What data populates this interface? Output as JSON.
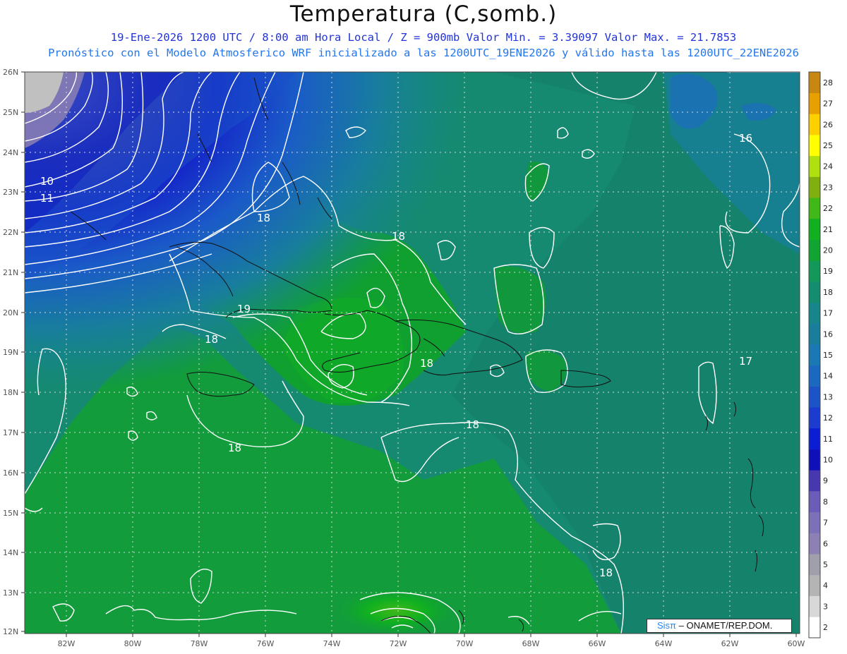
{
  "header": {
    "title": "Temperatura (C,somb.)",
    "line1": "19-Ene-2026  1200 UTC / 8:00 am Hora Local / Z = 900mb   Valor Min. = 3.39097  Valor Max. = 21.7853",
    "line2": "Pronóstico con el Modelo Atmosferico WRF inicializado a las 1200UTC_19ENE2026 y válido hasta las  1200UTC_22ENE2026"
  },
  "map": {
    "lat_labels": [
      "26N",
      "25N",
      "24N",
      "23N",
      "22N",
      "21N",
      "20N",
      "19N",
      "18N",
      "17N",
      "16N",
      "15N",
      "14N",
      "13N",
      "12N"
    ],
    "lon_labels": [
      "82W",
      "80W",
      "78W",
      "76W",
      "74W",
      "72W",
      "70W",
      "68W",
      "66W",
      "64W",
      "62W",
      "60W"
    ],
    "contour_labels": [
      {
        "id": "c10",
        "text": "10"
      },
      {
        "id": "c11",
        "text": "11"
      },
      {
        "id": "c16",
        "text": "16"
      },
      {
        "id": "c17",
        "text": "17"
      },
      {
        "id": "c18a",
        "text": "18"
      },
      {
        "id": "c18b",
        "text": "18"
      },
      {
        "id": "c18c",
        "text": "18"
      },
      {
        "id": "c18d",
        "text": "18"
      },
      {
        "id": "c18e",
        "text": "18"
      },
      {
        "id": "c18f",
        "text": "18"
      },
      {
        "id": "c18g",
        "text": "18"
      },
      {
        "id": "c19",
        "text": "19"
      }
    ]
  },
  "colorbar": {
    "labels": [
      "2",
      "3",
      "4",
      "5",
      "6",
      "7",
      "8",
      "9",
      "10",
      "11",
      "12",
      "13",
      "14",
      "15",
      "16",
      "17",
      "18",
      "19",
      "20",
      "21",
      "22",
      "23",
      "24",
      "25",
      "26",
      "27",
      "28"
    ],
    "colors": [
      "#ffffff",
      "#d8d8d8",
      "#b4b4b4",
      "#a0a0ac",
      "#8c80b4",
      "#7c70b8",
      "#6a5cb8",
      "#4838b0",
      "#1010b8",
      "#0c1ed4",
      "#1c3cd0",
      "#1c54c8",
      "#1a68c0",
      "#1a78b4",
      "#187e9c",
      "#16868a",
      "#148c70",
      "#129858",
      "#10a430",
      "#10b020",
      "#40b818",
      "#80b010",
      "#b0e010",
      "#ffff00",
      "#ffd000",
      "#e8a000",
      "#c88810"
    ]
  },
  "credit": {
    "sis": "Sisπ",
    "rest": "– ONAMET/REP.DOM."
  }
}
